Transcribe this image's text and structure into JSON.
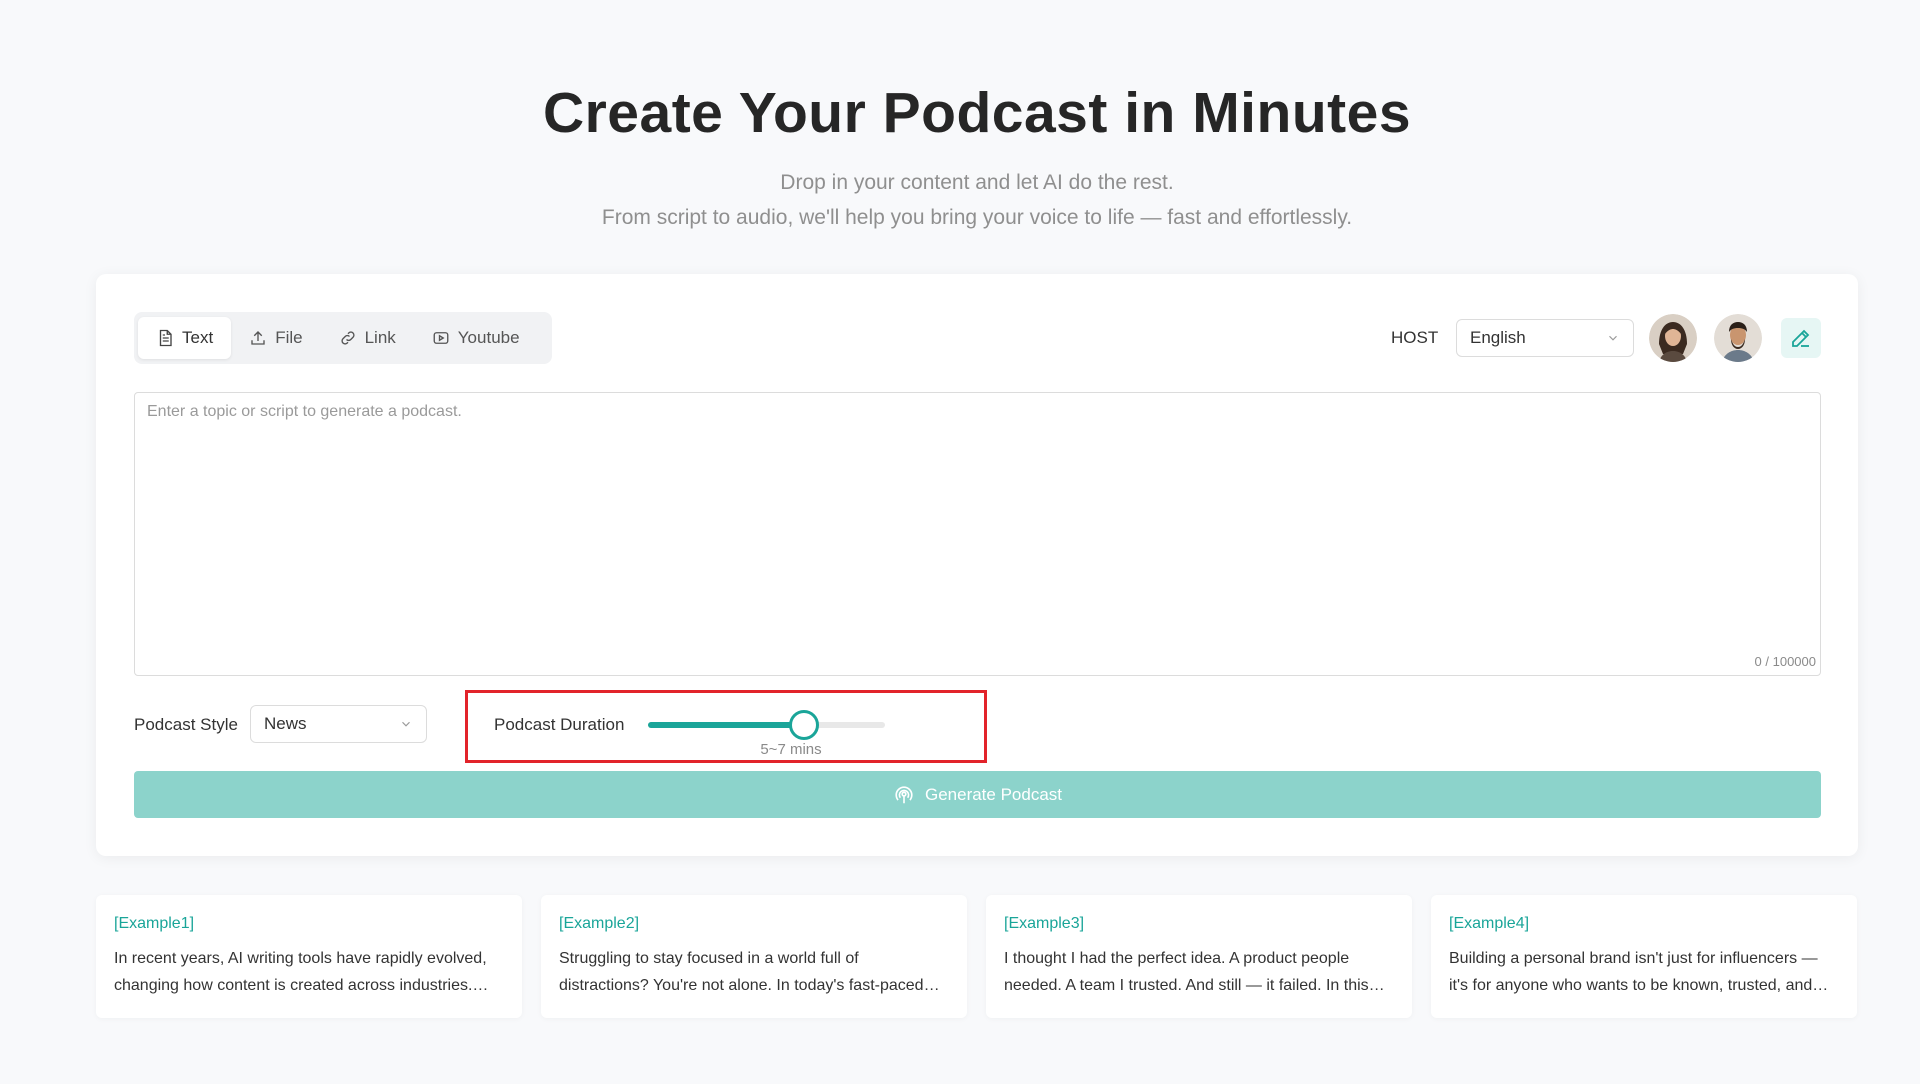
{
  "hero": {
    "title": "Create Your Podcast in Minutes",
    "subtitle_line1": "Drop in your content and let AI do the rest.",
    "subtitle_line2": "From script to audio, we'll help you bring your voice to life — fast and effortlessly."
  },
  "tabs": [
    {
      "label": "Text",
      "icon": "document-icon",
      "active": true
    },
    {
      "label": "File",
      "icon": "upload-icon",
      "active": false
    },
    {
      "label": "Link",
      "icon": "link-icon",
      "active": false
    },
    {
      "label": "Youtube",
      "icon": "youtube-icon",
      "active": false
    }
  ],
  "host": {
    "label": "HOST",
    "language": "English",
    "avatars": [
      "avatar-female",
      "avatar-male"
    ]
  },
  "topic": {
    "placeholder": "Enter a topic or script to generate a podcast.",
    "value": "",
    "counter": "0 / 100000"
  },
  "podcast_style": {
    "label": "Podcast Style",
    "selected": "News"
  },
  "podcast_duration": {
    "label": "Podcast Duration",
    "value_text": "5~7 mins",
    "slider_fraction": 0.66
  },
  "generate_button": {
    "label": "Generate Podcast"
  },
  "examples": [
    {
      "title": "[Example1]",
      "text": "In recent years, AI writing tools have rapidly evolved, changing how content is created across industries. From marketing to journalism, these tools are reshaping workflows."
    },
    {
      "title": "[Example2]",
      "text": "Struggling to stay focused in a world full of distractions? You're not alone. In today's fast-paced digital world, attention has become one of the scarcest resources."
    },
    {
      "title": "[Example3]",
      "text": "I thought I had the perfect idea. A product people needed. A team I trusted. And still — it failed. In this episode, I share what went wrong and what I learned."
    },
    {
      "title": "[Example4]",
      "text": "Building a personal brand isn't just for influencers — it's for anyone who wants to be known, trusted, and remembered in their field."
    }
  ],
  "colors": {
    "accent": "#1aa599",
    "button": "#8cd3cb",
    "highlight_border": "#e2232a"
  }
}
